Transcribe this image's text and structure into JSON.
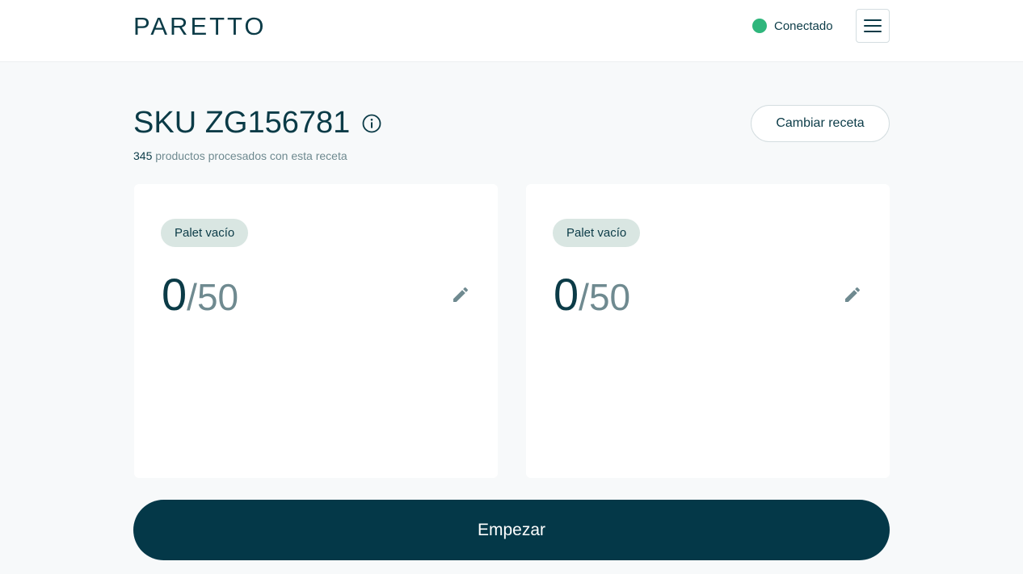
{
  "header": {
    "logo_text": "PARETTO",
    "status_label": "Conectado",
    "status_color": "#2fb67c",
    "menu_icon": "hamburger-menu-icon"
  },
  "recipe": {
    "title": "SKU ZG156781",
    "info_icon": "info-icon",
    "processed_count": "345",
    "processed_label": "productos procesados con esta receta",
    "change_button_label": "Cambiar receta"
  },
  "pallets": [
    {
      "status_label": "Palet vacío",
      "current": "0",
      "separator": "/",
      "capacity": "50",
      "edit_icon": "pencil-icon"
    },
    {
      "status_label": "Palet vacío",
      "current": "0",
      "separator": "/",
      "capacity": "50",
      "edit_icon": "pencil-icon"
    }
  ],
  "actions": {
    "start_label": "Empezar"
  },
  "colors": {
    "primary": "#043848",
    "background": "#f7f9fa",
    "badge_bg": "#d9e6e2",
    "muted_text": "#6f8a90"
  }
}
